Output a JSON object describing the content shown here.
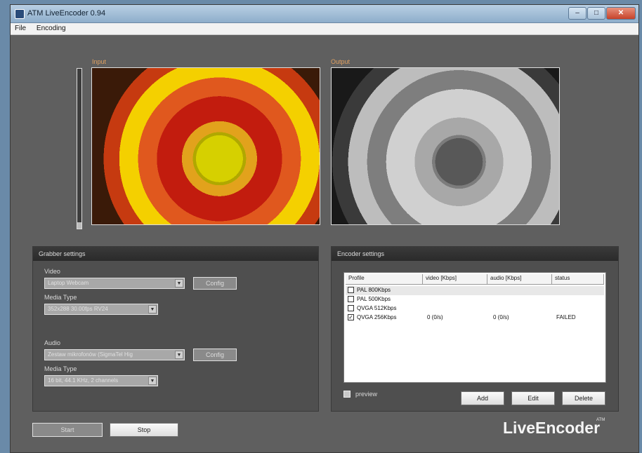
{
  "window": {
    "title": "ATM LiveEncoder 0.94",
    "controls": {
      "minimize": "–",
      "maximize": "□",
      "close": "✕"
    }
  },
  "menu": [
    "File",
    "Encoding"
  ],
  "audio_level": 0.04,
  "preview": {
    "input_label": "Input",
    "output_label": "Output"
  },
  "grabber": {
    "title": "Grabber settings",
    "video_label": "Video",
    "video_device": "Laptop Webcam",
    "video_config": "Config",
    "video_media_type_label": "Media Type",
    "video_media_type": "352x288 30.00fps RV24",
    "audio_label": "Audio",
    "audio_device": "Zestaw mikrofonów (SigmaTel Hig",
    "audio_config": "Config",
    "audio_media_type_label": "Media Type",
    "audio_media_type": "16 bit, 44.1 KHz, 2 channels"
  },
  "encoder": {
    "title": "Encoder settings",
    "columns": [
      "Profile",
      "video [Kbps]",
      "audio [Kbps]",
      "status"
    ],
    "rows": [
      {
        "profile": "PAL 800Kbps",
        "checked": false,
        "video": "",
        "audio": "",
        "status": ""
      },
      {
        "profile": "PAL 500Kbps",
        "checked": false,
        "video": "",
        "audio": "",
        "status": ""
      },
      {
        "profile": "QVGA 512Kbps",
        "checked": false,
        "video": "",
        "audio": "",
        "status": ""
      },
      {
        "profile": "QVGA 256Kbps",
        "checked": true,
        "video": "0 (0/s)",
        "audio": "0 (0/s)",
        "status": "FAILED"
      }
    ],
    "preview_label": "preview",
    "add": "Add",
    "edit": "Edit",
    "delete": "Delete"
  },
  "bottom": {
    "start": "Start",
    "stop": "Stop",
    "logo": "LiveEncoder",
    "logo_sup": "ATM"
  }
}
